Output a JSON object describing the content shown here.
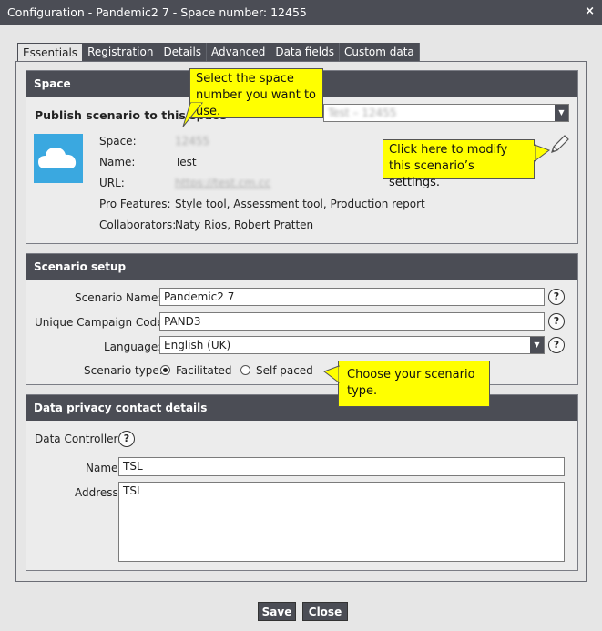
{
  "window": {
    "title": "Configuration - Pandemic2 7 - Space number: 12455",
    "close": "×"
  },
  "tabs": [
    "Essentials",
    "Registration",
    "Details",
    "Advanced",
    "Data fields",
    "Custom data"
  ],
  "space": {
    "heading": "Space",
    "publish_label": "Publish scenario to this space",
    "selected_space": "Test – 12455",
    "space_label": "Space:",
    "space_value": "12455",
    "name_label": "Name:",
    "name_value": "Test",
    "url_label": "URL:",
    "url_value": "https://test.cm.cc",
    "pro_label": "Pro Features:",
    "pro_value": "Style tool, Assessment tool, Production report",
    "collab_label": "Collaborators:",
    "collab_value": "Naty Rios, Robert Pratten"
  },
  "setup": {
    "heading": "Scenario setup",
    "scenario_name_label": "Scenario Name:",
    "scenario_name_value": "Pandemic2 7",
    "campaign_code_label": "Unique Campaign Code:",
    "campaign_code_value": "PAND3",
    "language_label": "Language:",
    "language_value": "English (UK)",
    "type_label": "Scenario type:",
    "type_facilitated": "Facilitated",
    "type_selfpaced": "Self-paced",
    "help": "?"
  },
  "privacy": {
    "heading": "Data privacy contact details",
    "controller_label": "Data Controller:",
    "name_label": "Name",
    "name_value": "TSL",
    "address_label": "Address",
    "address_value": "TSL"
  },
  "callouts": {
    "space_number": "Select the space number you want to use.",
    "modify": "Click here to modify this scenario’s settings.",
    "type": "Choose your scenario type."
  },
  "buttons": {
    "save": "Save",
    "close": "Close"
  },
  "icons": {
    "cloud": "cloud-icon",
    "edit": "pencil-icon",
    "dropdown": "chevron-down-icon",
    "help": "question-icon"
  }
}
